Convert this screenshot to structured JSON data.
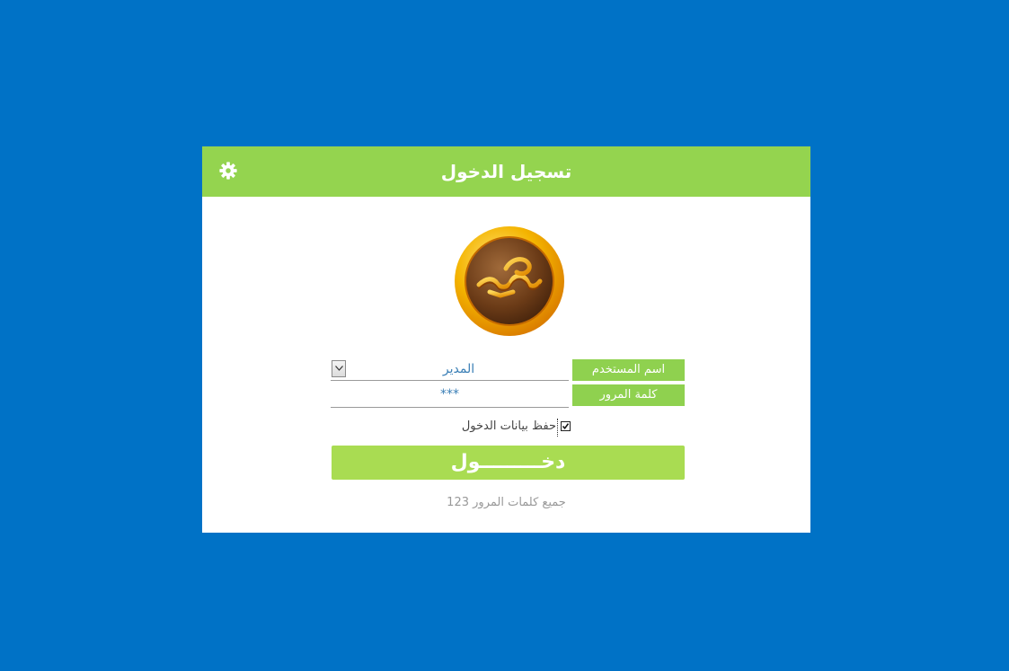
{
  "window": {
    "title": "تسجيل الدخول",
    "settings_icon": "gear-icon"
  },
  "logo": {
    "icon": "app-logo-emblem"
  },
  "form": {
    "username_label": "اسم المستخدم",
    "username_value": "المدير",
    "password_label": "كلمة المرور",
    "password_value": "***",
    "remember_label": "حفظ بيانات الدخول",
    "remember_checked": true,
    "login_button": "دخـــــــــول"
  },
  "footer": {
    "note": "جميع كلمات المرور 123"
  },
  "colors": {
    "background": "#0072c6",
    "header": "#94d44f",
    "button": "#a9dc52",
    "label_bg": "#8fd14f"
  }
}
